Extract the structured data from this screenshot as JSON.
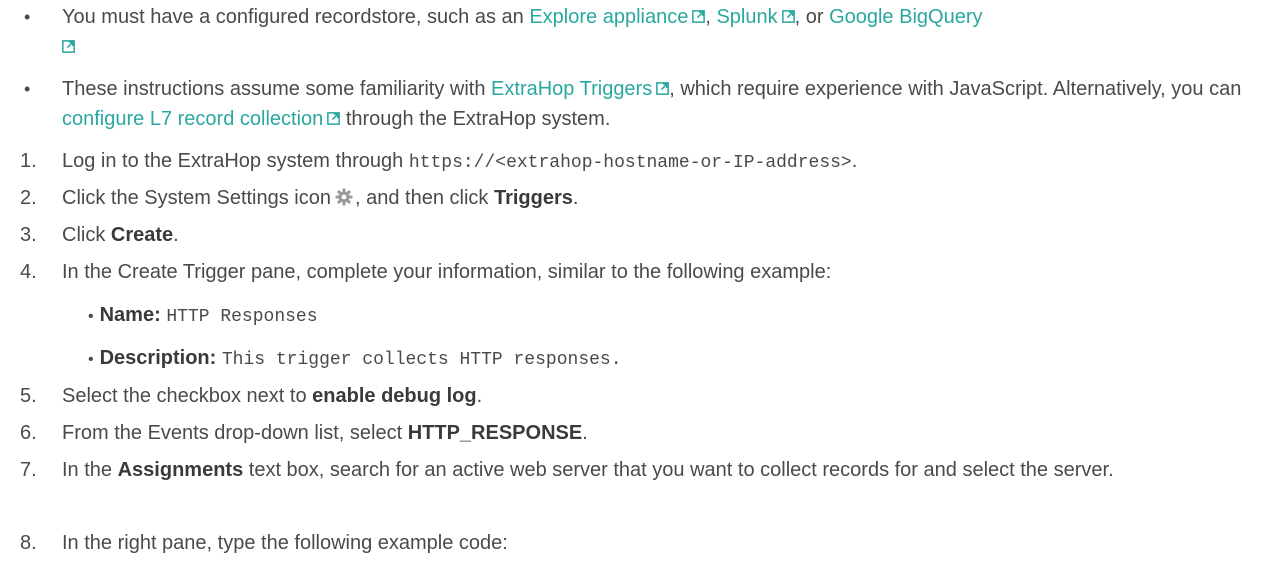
{
  "colors": {
    "link": "#2aa8a0",
    "text": "#4a4a4a",
    "bold": "#3a3a3a",
    "icon": "#9a9a9a"
  },
  "bullets": [
    {
      "marker": "•",
      "t1": "You must have a configured recordstore, such as an ",
      "link1": "Explore appliance",
      "t2": ", ",
      "link2": "Splunk",
      "t3": ", or ",
      "link3": "Google BigQuery"
    },
    {
      "marker": "•",
      "t1": "These instructions assume some familiarity with ",
      "link1": "ExtraHop Triggers",
      "t2": ", which require experience with JavaScript. Alternatively, you can ",
      "link2": "configure L7 record collection",
      "t3": " through the ExtraHop system."
    }
  ],
  "steps": [
    {
      "num": "1.",
      "pre": "Log in to the ExtraHop system through ",
      "code": "https://<extrahop-hostname-or-IP-address>",
      "post": "."
    },
    {
      "num": "2.",
      "pre": "Click the System Settings icon",
      "icon": "gear-icon",
      "mid": ", and then click ",
      "bold": "Triggers",
      "post": "."
    },
    {
      "num": "3.",
      "pre": "Click ",
      "bold": "Create",
      "post": "."
    },
    {
      "num": "4.",
      "text": "In the Create Trigger pane, complete your information, similar to the following example:"
    },
    {
      "num": "5.",
      "pre": "Select the checkbox next to ",
      "bold": "enable debug log",
      "post": "."
    },
    {
      "num": "6.",
      "pre": "From the Events drop-down list, select ",
      "bold": "HTTP_RESPONSE",
      "post": "."
    },
    {
      "num": "7.",
      "pre": "In the ",
      "bold": "Assignments",
      "post": " text box, search for an active web server that you want to collect records for and select the server."
    },
    {
      "num": "8.",
      "text": "In the right pane, type the following example code:"
    }
  ],
  "sub_items": [
    {
      "marker": "•",
      "label": "Name:",
      "value": "HTTP Responses"
    },
    {
      "marker": "•",
      "label": "Description:",
      "value": "This trigger collects HTTP responses."
    }
  ]
}
